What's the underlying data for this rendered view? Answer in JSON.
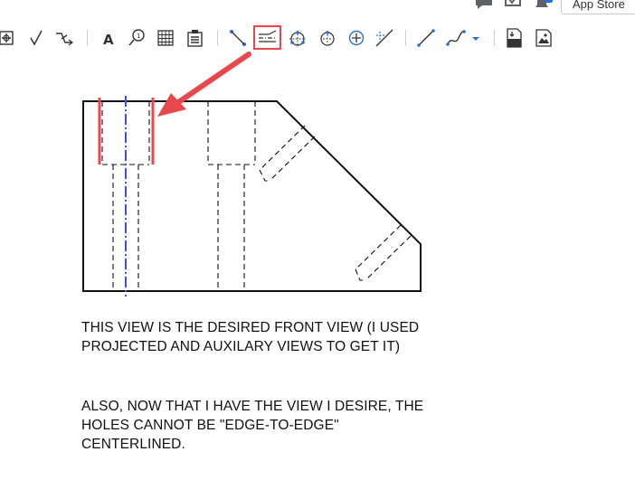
{
  "header": {
    "app_store_label": "App Store",
    "icons": [
      "chat-bubble-icon",
      "task-check-icon",
      "notification-bell-icon"
    ],
    "notification_accent": "#1e73d6"
  },
  "toolbar": {
    "items": [
      "view-frame-icon",
      "check-icon",
      "weld-symbol-icon",
      "text-icon",
      "callout-icon",
      "table-icon",
      "paste-table-icon",
      "point-line-icon",
      "centerline-icon",
      "center-mark-group-icon",
      "circle-center-icon",
      "center-mark-icon",
      "angle-line-icon",
      "line-icon",
      "spline-icon",
      "dropdown-caret-icon",
      "dxf-export-icon",
      "image-export-icon"
    ],
    "highlight_color": "#e8474c"
  },
  "annotation": {
    "arrow_color": "#e8474c",
    "hole_edge_color": "#e8474c",
    "centerline_color": "#3b4fe0"
  },
  "notes": {
    "paragraph1": "THIS VIEW IS THE DESIRED FRONT VIEW (I USED PROJECTED AND AUXILARY VIEWS TO GET IT)",
    "paragraph2": "ALSO, NOW THAT I HAVE THE VIEW I DESIRE, THE HOLES CANNOT BE \"EDGE-TO-EDGE\" CENTERLINED."
  }
}
